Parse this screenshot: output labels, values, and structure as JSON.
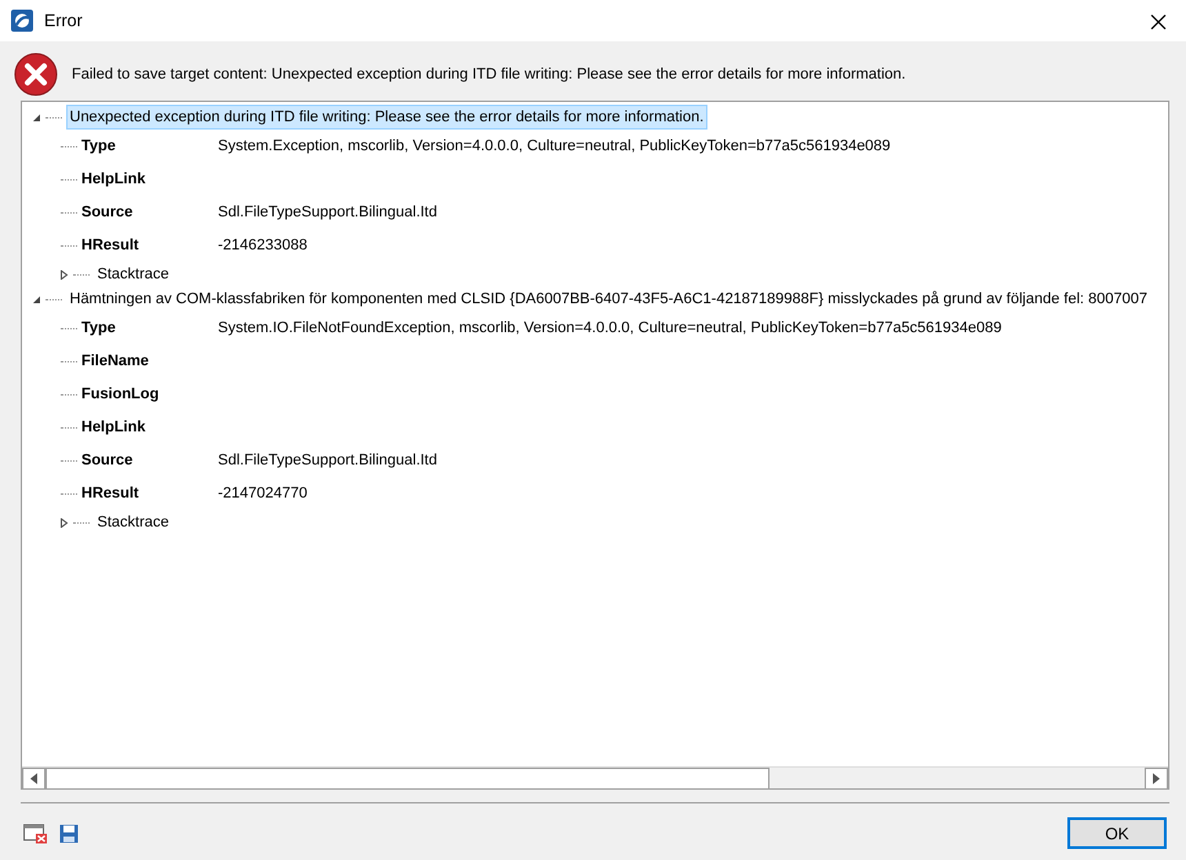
{
  "window": {
    "title": "Error"
  },
  "message": "Failed to save target content: Unexpected exception during ITD file writing: Please see the error details for more information.",
  "tree": [
    {
      "label": "Unexpected exception during ITD file writing: Please see the error details for more information.",
      "expanded": true,
      "selected": true,
      "properties": [
        {
          "name": "Type",
          "value": "System.Exception, mscorlib, Version=4.0.0.0, Culture=neutral, PublicKeyToken=b77a5c561934e089"
        },
        {
          "name": "HelpLink"
        },
        {
          "name": "Source",
          "value": "Sdl.FileTypeSupport.Bilingual.Itd"
        },
        {
          "name": "HResult",
          "value": "-2146233088"
        }
      ],
      "children": [
        {
          "label": "Stacktrace",
          "expanded": false,
          "selected": false
        }
      ]
    },
    {
      "label": "Hämtningen av COM-klassfabriken för komponenten med CLSID {DA6007BB-6407-43F5-A6C1-42187189988F} misslyckades på grund av följande fel: 8007007",
      "expanded": true,
      "selected": false,
      "properties": [
        {
          "name": "Type",
          "value": "System.IO.FileNotFoundException, mscorlib, Version=4.0.0.0, Culture=neutral, PublicKeyToken=b77a5c561934e089"
        },
        {
          "name": "FileName"
        },
        {
          "name": "FusionLog"
        },
        {
          "name": "HelpLink"
        },
        {
          "name": "Source",
          "value": "Sdl.FileTypeSupport.Bilingual.Itd"
        },
        {
          "name": "HResult",
          "value": "-2147024770"
        }
      ],
      "children": [
        {
          "label": "Stacktrace",
          "expanded": false,
          "selected": false
        }
      ]
    }
  ],
  "buttons": [
    {
      "label": "OK",
      "default": true
    }
  ]
}
